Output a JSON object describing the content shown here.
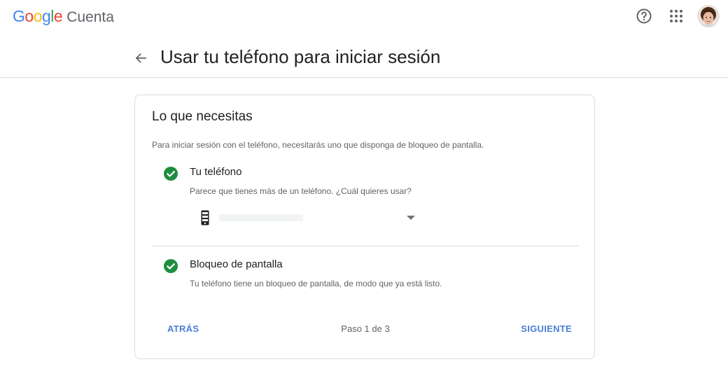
{
  "brand": {
    "google_letters": [
      {
        "ch": "G",
        "color": "#4285F4"
      },
      {
        "ch": "o",
        "color": "#EA4335"
      },
      {
        "ch": "o",
        "color": "#FBBC05"
      },
      {
        "ch": "g",
        "color": "#4285F4"
      },
      {
        "ch": "l",
        "color": "#34A853"
      },
      {
        "ch": "e",
        "color": "#EA4335"
      }
    ],
    "product": "Cuenta"
  },
  "topbar": {
    "help_icon": "help-circle-icon",
    "apps_icon": "apps-grid-icon",
    "avatar": "avatar"
  },
  "header": {
    "title": "Usar tu teléfono para iniciar sesión",
    "back_icon": "arrow-back-icon"
  },
  "card": {
    "title": "Lo que necesitas",
    "description": "Para iniciar sesión con el teléfono, necesitarás uno que disponga de bloqueo de pantalla.",
    "requirements": [
      {
        "title": "Tu teléfono",
        "subtitle": "Parece que tienes más de un teléfono. ¿Cuál quieres usar?",
        "status_icon": "check-circle-icon"
      },
      {
        "title": "Bloqueo de pantalla",
        "subtitle": "Tu teléfono tiene un bloqueo de pantalla, de modo que ya está listo.",
        "status_icon": "check-circle-icon"
      }
    ],
    "device_select": {
      "icon": "phone-icon",
      "selected": ""
    },
    "footer": {
      "back_label": "ATRÁS",
      "step_label": "Paso 1 de 3",
      "next_label": "SIGUIENTE"
    }
  },
  "colors": {
    "accent": "#4a80d6",
    "check_green": "#1e8e3e",
    "divider": "#dadce0"
  }
}
